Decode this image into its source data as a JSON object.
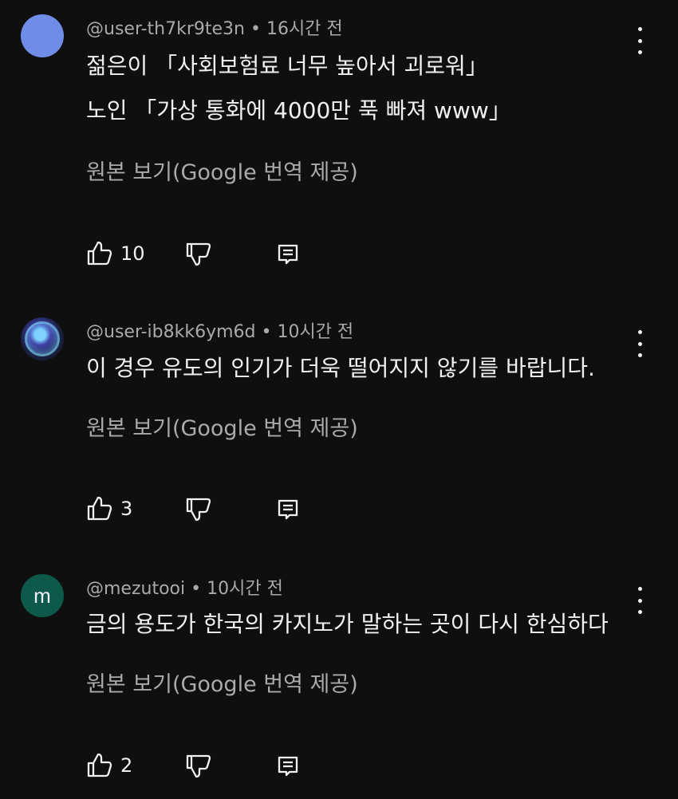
{
  "comments": [
    {
      "handle": "@user-th7kr9te3n",
      "time": "16시간 전",
      "lines": [
        "젊은이 「사회보험료 너무 높아서 괴로워」",
        "노인 「가상 통화에 4000만 푹 빠져 www」"
      ],
      "translate_label": "원본 보기(Google 번역 제공)",
      "likes": "10",
      "avatar_color": "#6f8de6"
    },
    {
      "handle": "@user-ib8kk6ym6d",
      "time": "10시간 전",
      "lines": [
        "이 경우 유도의 인기가 더욱 떨어지지 않기를 바랍니다."
      ],
      "translate_label": "원본 보기(Google 번역 제공)",
      "likes": "3"
    },
    {
      "handle": "@mezutooi",
      "time": "10시간 전",
      "avatar_letter": "m",
      "lines": [
        "금의 용도가 한국의 카지노가 말하는 곳이 다시 한심하다"
      ],
      "translate_label": "원본 보기(Google 번역 제공)",
      "likes": "2",
      "avatar_color": "#0d5a4b"
    }
  ],
  "icons": {
    "like": "thumb-up-icon",
    "dislike": "thumb-down-icon",
    "reply": "reply-icon",
    "more": "more-vert-icon"
  },
  "colors": {
    "background": "#0f0f0f",
    "primary_text": "#f1f1f1",
    "secondary_text": "#aaaaaa"
  }
}
